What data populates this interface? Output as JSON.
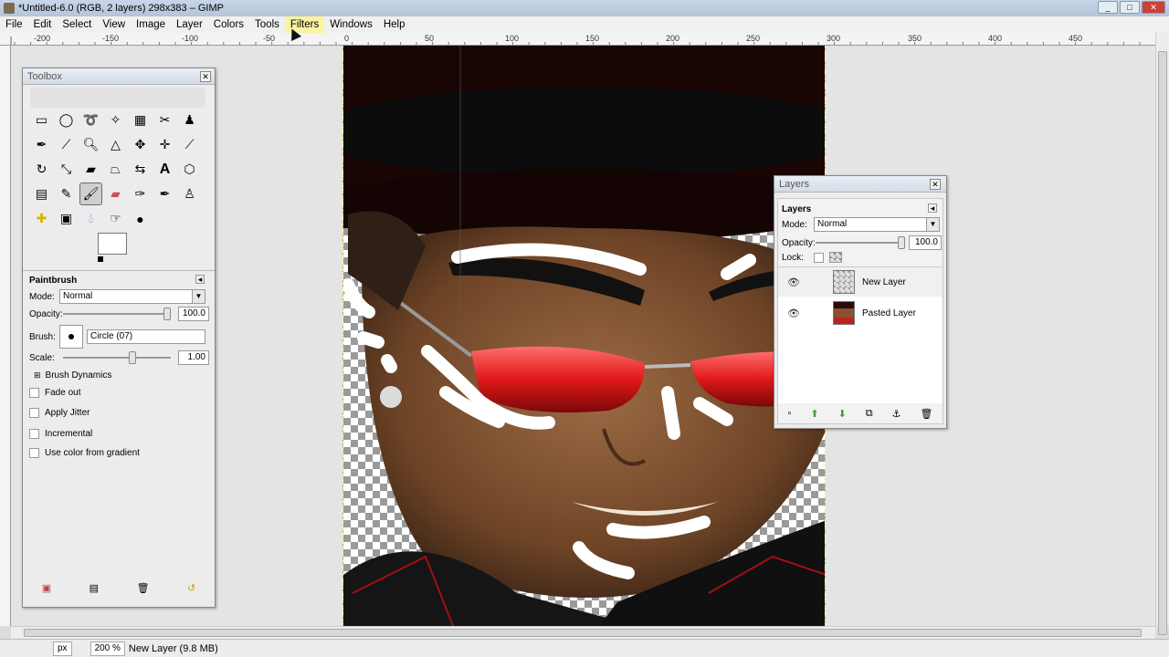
{
  "window": {
    "title": "*Untitled-6.0 (RGB, 2 layers) 298x383 – GIMP"
  },
  "menu": [
    "File",
    "Edit",
    "Select",
    "View",
    "Image",
    "Layer",
    "Colors",
    "Tools",
    "Filters",
    "Windows",
    "Help"
  ],
  "ruler": {
    "h_labels": [
      "-200",
      "-150",
      "-100",
      "-50",
      "0",
      "50",
      "100",
      "150",
      "200",
      "250",
      "300",
      "350",
      "400",
      "450"
    ]
  },
  "toolbox": {
    "title": "Toolbox",
    "tools": [
      "rect-select",
      "ellipse-select",
      "free-select",
      "fuzzy-select",
      "select-by-color",
      "scissors",
      "foreground-select",
      "paths",
      "color-picker",
      "zoom",
      "measure",
      "move",
      "align",
      "crop",
      "rotate",
      "scale",
      "shear",
      "perspective",
      "flip",
      "text",
      "cage",
      "blend",
      "pencil",
      "paintbrush",
      "eraser",
      "airbrush",
      "ink",
      "clone",
      "heal",
      "perspective-clone",
      "blur",
      "smudge",
      "dodge-burn"
    ],
    "options": {
      "heading": "Paintbrush",
      "mode_label": "Mode:",
      "mode_value": "Normal",
      "opacity_label": "Opacity:",
      "opacity_value": "100.0",
      "brush_label": "Brush:",
      "brush_value": "Circle (07)",
      "scale_label": "Scale:",
      "scale_value": "1.00",
      "dynamics_label": "Brush Dynamics",
      "fade_label": "Fade out",
      "jitter_label": "Apply Jitter",
      "incremental_label": "Incremental",
      "gradient_label": "Use color from gradient"
    }
  },
  "layers": {
    "title": "Layers",
    "heading": "Layers",
    "mode_label": "Mode:",
    "mode_value": "Normal",
    "opacity_label": "Opacity:",
    "opacity_value": "100.0",
    "lock_label": "Lock:",
    "items": [
      {
        "name": "New Layer"
      },
      {
        "name": "Pasted Layer"
      }
    ]
  },
  "status": {
    "unit": "px",
    "zoom": "200 %",
    "info": "New Layer (9.8 MB)"
  },
  "colors": {
    "accent": "#fbf3a0",
    "canvas_bg": "#e4e4e4",
    "paint": "#ffffff"
  }
}
